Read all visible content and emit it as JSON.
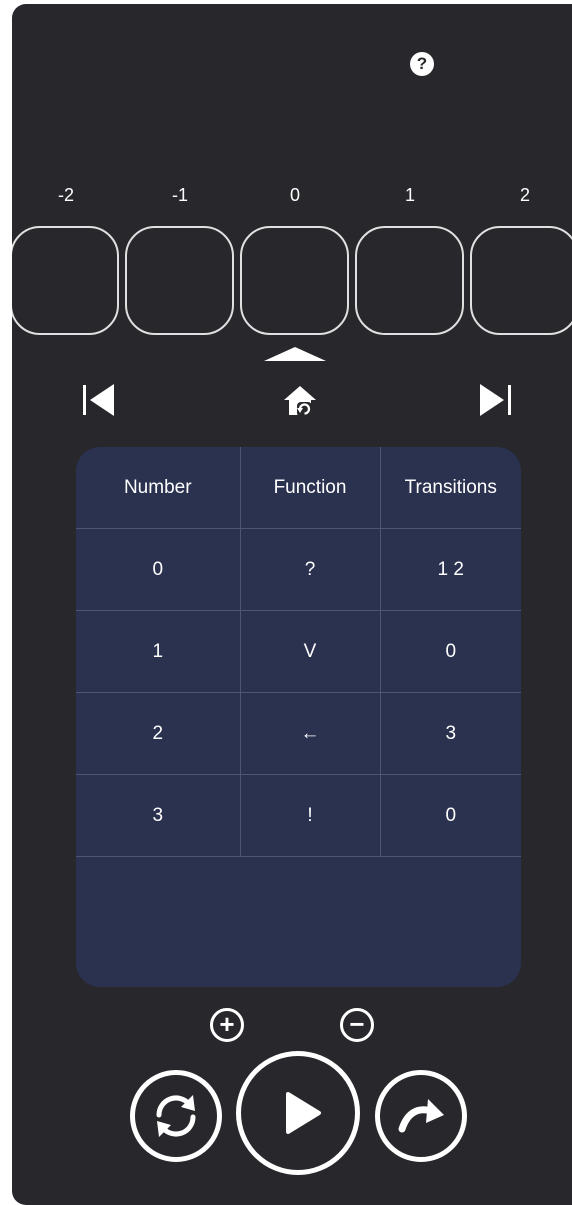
{
  "help": {
    "label": "?"
  },
  "tape": {
    "indices": [
      "-2",
      "-1",
      "0",
      "1",
      "2"
    ]
  },
  "table": {
    "headers": [
      "Number",
      "Function",
      "Transitions"
    ],
    "rows": [
      [
        "0",
        "?",
        "1 2"
      ],
      [
        "1",
        "V",
        "0"
      ],
      [
        "2",
        "←",
        "3"
      ],
      [
        "3",
        "!",
        "0"
      ]
    ]
  },
  "controls": {
    "add_label": "+",
    "remove_label": "−"
  },
  "icons": {
    "help": "question-icon",
    "prev": "skip-back-icon",
    "home": "home-icon",
    "next": "skip-forward-icon",
    "reset": "sync-icon",
    "play": "play-icon",
    "step": "redo-icon"
  },
  "colors": {
    "background": "#28272b",
    "table_bg": "#2b3250",
    "accent": "#ffffff"
  }
}
